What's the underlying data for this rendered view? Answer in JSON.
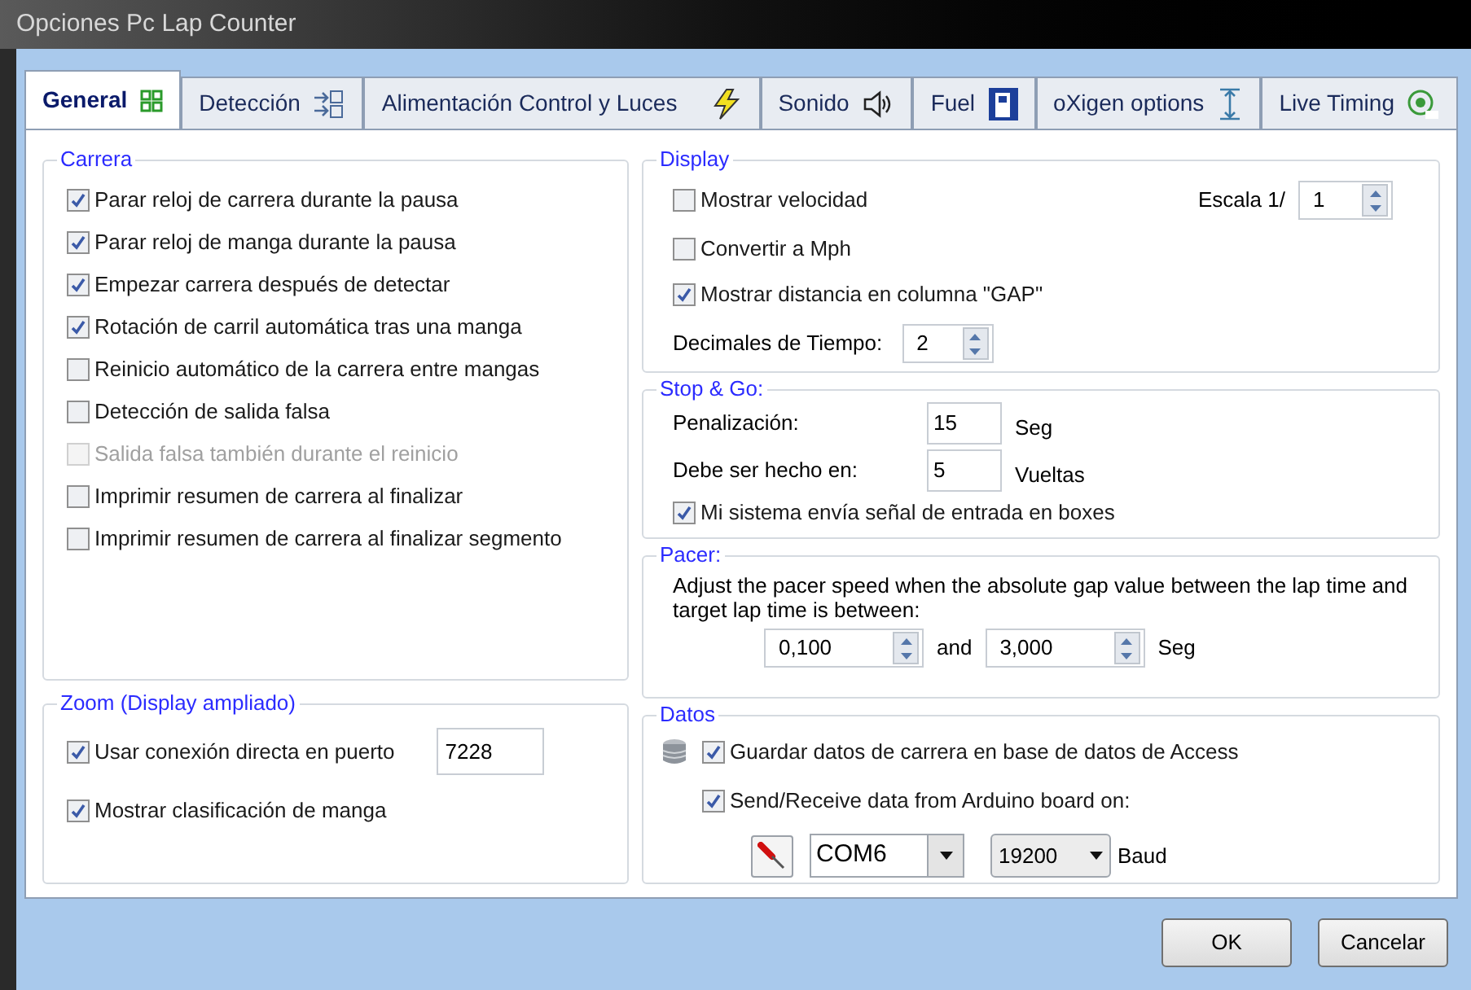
{
  "window": {
    "title": "Opciones Pc Lap Counter"
  },
  "tabs": [
    {
      "label": "General",
      "selected": true
    },
    {
      "label": "Detección",
      "selected": false
    },
    {
      "label": "Alimentación Control y Luces",
      "selected": false
    },
    {
      "label": "Sonido",
      "selected": false
    },
    {
      "label": "Fuel",
      "selected": false
    },
    {
      "label": "oXigen options",
      "selected": false
    },
    {
      "label": "Live Timing",
      "selected": false
    }
  ],
  "carrera": {
    "title": "Carrera",
    "options": [
      {
        "label": "Parar reloj de carrera durante la pausa",
        "checked": true,
        "disabled": false
      },
      {
        "label": "Parar reloj de manga durante la pausa",
        "checked": true,
        "disabled": false
      },
      {
        "label": "Empezar carrera después de detectar",
        "checked": true,
        "disabled": false
      },
      {
        "label": "Rotación de carril automática tras una manga",
        "checked": true,
        "disabled": false
      },
      {
        "label": "Reinicio automático de la carrera entre mangas",
        "checked": false,
        "disabled": false
      },
      {
        "label": "Detección de salida falsa",
        "checked": false,
        "disabled": false
      },
      {
        "label": "Salida falsa también durante el reinicio",
        "checked": false,
        "disabled": true
      },
      {
        "label": "Imprimir resumen de carrera al finalizar",
        "checked": false,
        "disabled": false
      },
      {
        "label": "Imprimir resumen de carrera al finalizar segmento",
        "checked": false,
        "disabled": false
      }
    ]
  },
  "zoom": {
    "title": "Zoom (Display ampliado)",
    "port": "7228",
    "options": [
      {
        "label": "Usar conexión directa en puerto",
        "checked": true
      },
      {
        "label": "Mostrar clasificación de manga",
        "checked": true
      }
    ]
  },
  "display": {
    "title": "Display",
    "options": [
      {
        "label": "Mostrar velocidad",
        "checked": false
      },
      {
        "label": "Convertir a Mph",
        "checked": false
      },
      {
        "label": "Mostrar distancia en columna \"GAP\"",
        "checked": true
      }
    ],
    "scale": {
      "label": "Escala 1/",
      "value": "1"
    },
    "decimals": {
      "label": "Decimales de Tiempo:",
      "value": "2"
    }
  },
  "stop_go": {
    "title": "Stop & Go:",
    "rows": [
      {
        "label": "Penalización:",
        "value": "15",
        "unit": "Seg"
      },
      {
        "label": "Debe ser hecho en:",
        "value": "5",
        "unit": "Vueltas"
      }
    ],
    "option": {
      "label": "Mi sistema envía señal de entrada en boxes",
      "checked": true
    }
  },
  "pacer": {
    "title": "Pacer:",
    "text": "Adjust the pacer speed when the absolute gap value between the lap time and target lap time is between:",
    "min": "0,100",
    "joiner": "and",
    "max": "3,000",
    "unit": "Seg"
  },
  "datos": {
    "title": "Datos",
    "options": [
      {
        "label": "Guardar datos de carrera en base de datos de Access",
        "checked": true
      },
      {
        "label": "Send/Receive data from Arduino board on:",
        "checked": true
      }
    ],
    "port": "COM6",
    "baud": "19200",
    "baud_unit": "Baud"
  },
  "buttons": [
    {
      "label": "OK"
    },
    {
      "label": "Cancelar"
    }
  ]
}
